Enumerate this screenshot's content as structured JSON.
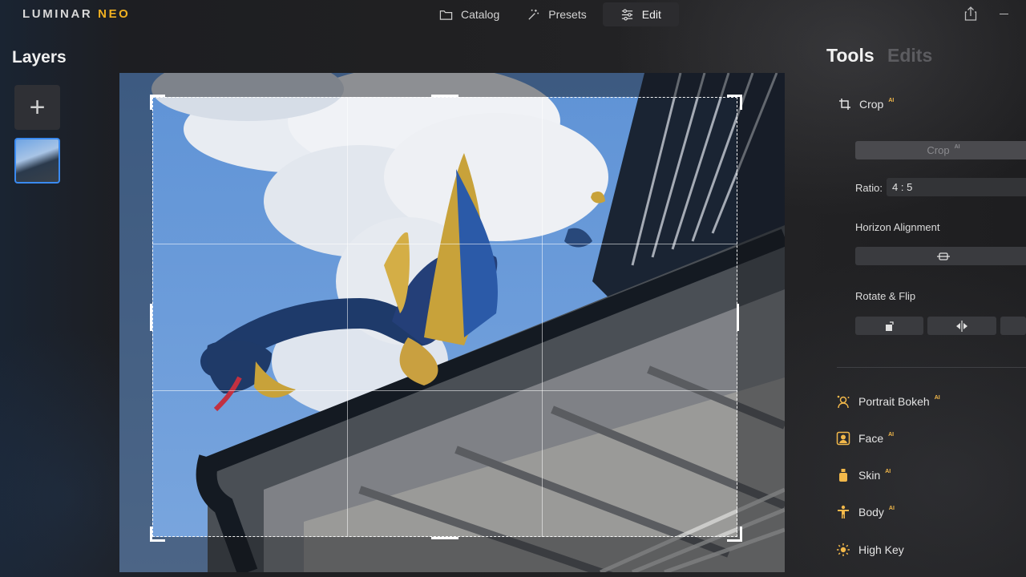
{
  "app": {
    "logo_main": "LUMINAR",
    "logo_accent": "NEO"
  },
  "nav": {
    "catalog": "Catalog",
    "presets": "Presets",
    "edit": "Edit"
  },
  "layers": {
    "title": "Layers"
  },
  "panel": {
    "tab_tools": "Tools",
    "tab_edits": "Edits",
    "crop_tool": {
      "label": "Crop",
      "ai": "AI"
    },
    "crop_button": {
      "label": "Crop",
      "ai": "AI"
    },
    "ratio": {
      "label": "Ratio:",
      "value": "4 : 5"
    },
    "horizon_label": "Horizon Alignment",
    "rotate_label": "Rotate & Flip",
    "tools": [
      {
        "label": "Portrait Bokeh",
        "ai": "AI",
        "icon": "portrait-bokeh-icon"
      },
      {
        "label": "Face",
        "ai": "AI",
        "icon": "face-icon"
      },
      {
        "label": "Skin",
        "ai": "AI",
        "icon": "skin-icon"
      },
      {
        "label": "Body",
        "ai": "AI",
        "icon": "body-icon"
      },
      {
        "label": "High Key",
        "ai": "",
        "icon": "high-key-icon"
      }
    ]
  },
  "colors": {
    "accent": "#f0b020",
    "selection": "#3a8af0",
    "ai_badge": "#f2b84a"
  }
}
